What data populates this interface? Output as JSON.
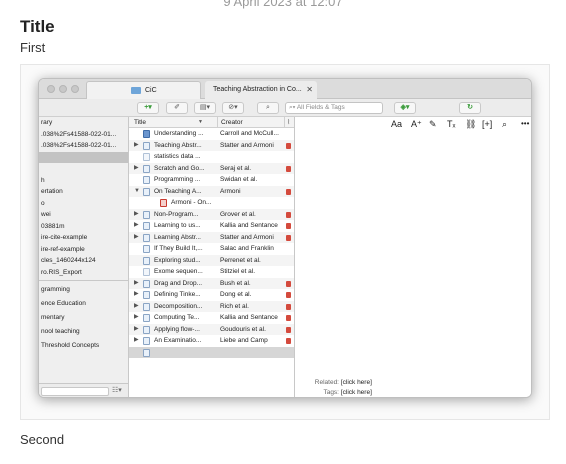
{
  "note": {
    "timestamp": "9 April 2023 at 12:07",
    "title": "Title",
    "first": "First",
    "second": "Second"
  },
  "zotero": {
    "tabs": [
      {
        "label": "CiC"
      },
      {
        "label": "Teaching Abstraction in Co..."
      }
    ],
    "toolbar": {
      "search_placeholder": "All Fields & Tags",
      "search_glyph": "⌕▾",
      "new_item": "+▾",
      "add_by_id": "✐",
      "new_note": "▤▾",
      "attach": "⊘▾",
      "locate": "⌕",
      "locate_menu": "◈▾",
      "sync": "↻"
    },
    "collections": [
      {
        "label": "rary",
        "selected": false
      },
      {
        "label": ".038%2Fs41588-022-01...",
        "selected": false
      },
      {
        "label": ".038%2Fs41588-022-01...",
        "selected": false
      },
      {
        "label": "",
        "selected": true
      },
      {
        "label": "",
        "selected": false
      },
      {
        "label": "h",
        "selected": false
      },
      {
        "label": "ertation",
        "selected": false
      },
      {
        "label": "o",
        "selected": false
      },
      {
        "label": "wei",
        "selected": false
      },
      {
        "label": "03881m",
        "selected": false
      },
      {
        "label": "ire-cite-example",
        "selected": false
      },
      {
        "label": "ire-ref-example",
        "selected": false
      },
      {
        "label": "cles_1460244x124",
        "selected": false
      },
      {
        "label": "ro.RIS_Export",
        "selected": false
      }
    ],
    "tags": [
      "gramming",
      "ence Education",
      "mentary",
      "nool teaching",
      "Threshold Concepts"
    ],
    "left_menu_glyph": "☷▾",
    "items_header": {
      "title": "Title",
      "sort": "▼",
      "creator": "Creator",
      "attach": "📎"
    },
    "items": [
      {
        "title": "Understanding ...",
        "creator": "Carroll and McCull...",
        "icon": "book",
        "twisty": "",
        "attach": false
      },
      {
        "title": "Teaching Abstr...",
        "creator": "Statter and Armoni",
        "icon": "doc",
        "twisty": "▶",
        "attach": true
      },
      {
        "title": "statistics data ...",
        "creator": "",
        "icon": "web",
        "twisty": "",
        "attach": false
      },
      {
        "title": "Scratch and Go...",
        "creator": "Seraj et al.",
        "icon": "doc",
        "twisty": "▶",
        "attach": true
      },
      {
        "title": "Programming ...",
        "creator": "Swidan et al.",
        "icon": "doc",
        "twisty": "",
        "attach": false
      },
      {
        "title": "On Teaching A...",
        "creator": "Armoni",
        "icon": "doc",
        "twisty": "▼",
        "attach": true
      },
      {
        "title": "Armoni - On...",
        "creator": "",
        "icon": "pdf",
        "twisty": "",
        "attach": false,
        "child": true
      },
      {
        "title": "Non-Program...",
        "creator": "Grover et al.",
        "icon": "doc",
        "twisty": "▶",
        "attach": true
      },
      {
        "title": "Learning to us...",
        "creator": "Kallia and Sentance",
        "icon": "doc",
        "twisty": "▶",
        "attach": true
      },
      {
        "title": "Learning Abstr...",
        "creator": "Statter and Armoni",
        "icon": "doc",
        "twisty": "▶",
        "attach": true
      },
      {
        "title": "If They Build It,...",
        "creator": "Salac and Franklin",
        "icon": "doc",
        "twisty": "",
        "attach": false
      },
      {
        "title": "Exploring stud...",
        "creator": "Perrenet et al.",
        "icon": "doc",
        "twisty": "",
        "attach": false
      },
      {
        "title": "Exome sequen...",
        "creator": "Stitziel et al.",
        "icon": "web",
        "twisty": "",
        "attach": false
      },
      {
        "title": "Drag and Drop...",
        "creator": "Bush et al.",
        "icon": "doc",
        "twisty": "▶",
        "attach": true
      },
      {
        "title": "Defining Tinke...",
        "creator": "Dong et al.",
        "icon": "doc",
        "twisty": "▶",
        "attach": true
      },
      {
        "title": "Decomposition...",
        "creator": "Rich et al.",
        "icon": "doc",
        "twisty": "▶",
        "attach": true
      },
      {
        "title": "Computing Te...",
        "creator": "Kallia and Sentance",
        "icon": "doc",
        "twisty": "▶",
        "attach": true
      },
      {
        "title": "Applying flow-...",
        "creator": "Goudouris et al.",
        "icon": "doc",
        "twisty": "▶",
        "attach": true
      },
      {
        "title": "An Examinatio...",
        "creator": "Liebe and Camp",
        "icon": "doc",
        "twisty": "▶",
        "attach": true
      },
      {
        "title": "",
        "creator": "",
        "icon": "doc",
        "twisty": "",
        "attach": false,
        "selected": true
      }
    ],
    "note_toolbar": {
      "font": "Aa",
      "text_size": "A⁺",
      "highlight": "✎",
      "clear_format": "Tₓ",
      "link": "⛓",
      "citation": "[+]",
      "find": "⌕",
      "more": "•••"
    },
    "related": {
      "label": "Related:",
      "value": "[click here]"
    },
    "tags_field": {
      "label": "Tags:",
      "value": "[click here]"
    }
  }
}
